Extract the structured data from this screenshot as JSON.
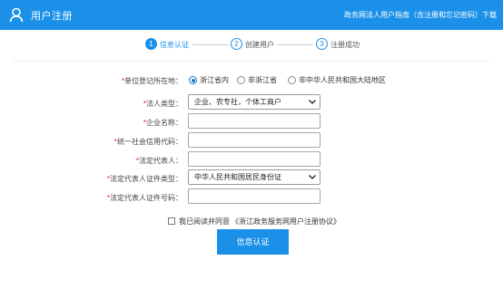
{
  "header": {
    "title": "用户注册",
    "guide_link": "政务网法人用户指南（含注册和忘记密码）下载"
  },
  "steps": [
    {
      "number": "1",
      "label": "信息认证",
      "active": true
    },
    {
      "number": "2",
      "label": "创建用户",
      "active": false
    },
    {
      "number": "3",
      "label": "注册成功",
      "active": false
    }
  ],
  "form": {
    "location": {
      "label": "单位登记所在地：",
      "options": [
        "浙江省内",
        "非浙江省",
        "非中华人民共和国大陆地区"
      ],
      "selected": "浙江省内"
    },
    "legal_type": {
      "label": "法人类型：",
      "value": "企业、农专社，个体工商户"
    },
    "company_name": {
      "label": "企业名称：",
      "value": ""
    },
    "credit_code": {
      "label": "统一社会信用代码：",
      "value": ""
    },
    "legal_rep": {
      "label": "法定代表人：",
      "value": ""
    },
    "id_type": {
      "label": "法定代表人证件类型：",
      "value": "中华人民共和国居民身份证"
    },
    "id_number": {
      "label": "法定代表人证件号码：",
      "value": ""
    }
  },
  "agreement": {
    "checked": false,
    "text": "我已阅读并同意",
    "link": "《浙江政务服务网用户注册协议》"
  },
  "submit_label": "信息认证",
  "colors": {
    "brand": "#1a90e8",
    "required": "#e02020"
  }
}
